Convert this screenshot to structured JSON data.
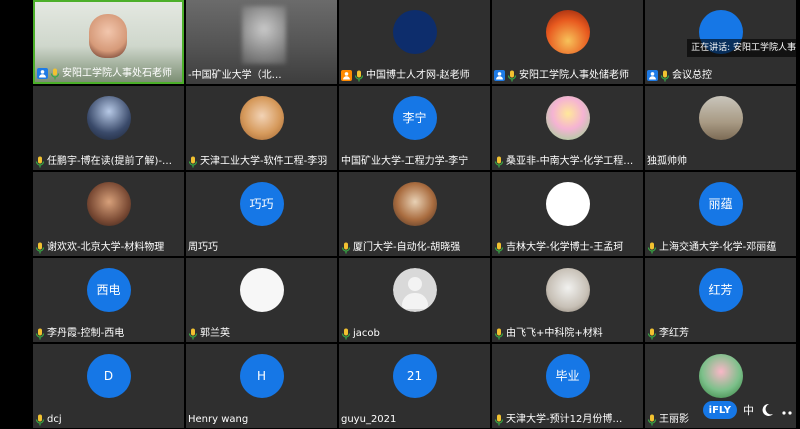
{
  "speaking_banner": "正在讲话: 安阳工学院人事",
  "tiles": [
    {
      "name": "tile-1",
      "label": "安阳工学院人事处石老师",
      "host": true,
      "hostBadge": "blue",
      "mic": true,
      "kind": "video-1",
      "active": true
    },
    {
      "name": "tile-2",
      "label": "-中国矿业大学（北…",
      "host": false,
      "mic": false,
      "kind": "video-2",
      "active": false
    },
    {
      "name": "tile-3",
      "label": "中国博士人才网-赵老师",
      "host": true,
      "hostBadge": "orange",
      "mic": true,
      "kind": "img",
      "imgClass": "logo1",
      "active": false
    },
    {
      "name": "tile-4",
      "label": "安阳工学院人事处储老师",
      "host": true,
      "hostBadge": "blue",
      "mic": true,
      "kind": "img",
      "imgClass": "logo2",
      "active": false
    },
    {
      "name": "tile-5",
      "label": "会议总控",
      "host": true,
      "hostBadge": "blue",
      "mic": true,
      "kind": "img",
      "imgClass": "partial",
      "active": false
    },
    {
      "name": "tile-6",
      "label": "任鹏宇-博在读(提前了解)-…",
      "host": false,
      "mic": true,
      "kind": "img",
      "imgClass": "c1",
      "active": false
    },
    {
      "name": "tile-7",
      "label": "天津工业大学-软件工程-李羽",
      "host": false,
      "mic": true,
      "kind": "img",
      "imgClass": "c2",
      "active": false
    },
    {
      "name": "tile-8",
      "label": "中国矿业大学-工程力学-李宁",
      "host": false,
      "mic": false,
      "kind": "text",
      "avatarText": "李宁",
      "active": false
    },
    {
      "name": "tile-9",
      "label": "桑亚非-中南大学-化学工程…",
      "host": false,
      "mic": true,
      "kind": "img",
      "imgClass": "c3",
      "active": false
    },
    {
      "name": "tile-10",
      "label": "独孤帅帅",
      "host": false,
      "mic": false,
      "kind": "img",
      "imgClass": "c4",
      "active": false
    },
    {
      "name": "tile-11",
      "label": "谢欢欢-北京大学-材料物理",
      "host": false,
      "mic": true,
      "kind": "img",
      "imgClass": "c5",
      "active": false
    },
    {
      "name": "tile-12",
      "label": "周巧巧",
      "host": false,
      "mic": false,
      "kind": "text",
      "avatarText": "巧巧",
      "active": false
    },
    {
      "name": "tile-13",
      "label": "厦门大学-自动化-胡晓强",
      "host": false,
      "mic": true,
      "kind": "img",
      "imgClass": "c6",
      "active": false
    },
    {
      "name": "tile-14",
      "label": "吉林大学-化学博士-王孟珂",
      "host": false,
      "mic": true,
      "kind": "img",
      "imgClass": "c7",
      "active": false
    },
    {
      "name": "tile-15",
      "label": "上海交通大学-化学-邓丽蕴",
      "host": false,
      "mic": true,
      "kind": "text",
      "avatarText": "丽蕴",
      "active": false
    },
    {
      "name": "tile-16",
      "label": "李丹霞-控制-西电",
      "host": false,
      "mic": true,
      "kind": "text",
      "avatarText": "西电",
      "active": false
    },
    {
      "name": "tile-17",
      "label": "郭兰英",
      "host": false,
      "mic": true,
      "kind": "img",
      "imgClass": "c8",
      "active": false
    },
    {
      "name": "tile-18",
      "label": "jacob",
      "host": false,
      "mic": true,
      "kind": "default",
      "active": false
    },
    {
      "name": "tile-19",
      "label": "由飞飞+中科院+材料",
      "host": false,
      "mic": true,
      "kind": "img",
      "imgClass": "c10",
      "active": false
    },
    {
      "name": "tile-20",
      "label": "李红芳",
      "host": false,
      "mic": true,
      "kind": "text",
      "avatarText": "红芳",
      "active": false
    },
    {
      "name": "tile-21",
      "label": "dcj",
      "host": false,
      "mic": true,
      "kind": "text",
      "avatarText": "D",
      "active": false
    },
    {
      "name": "tile-22",
      "label": "Henry wang",
      "host": false,
      "mic": false,
      "kind": "text",
      "avatarText": "H",
      "active": false
    },
    {
      "name": "tile-23",
      "label": "guyu_2021",
      "host": false,
      "mic": false,
      "kind": "text",
      "avatarText": "21",
      "active": false
    },
    {
      "name": "tile-24",
      "label": "天津大学-预计12月份博…",
      "host": false,
      "mic": true,
      "kind": "text",
      "avatarText": "毕业",
      "active": false
    },
    {
      "name": "tile-25",
      "label": "王丽影",
      "host": false,
      "mic": true,
      "kind": "img",
      "imgClass": "c11",
      "active": false
    }
  ],
  "toolbar": {
    "ime_label": "iFLY",
    "ime_lang": "中"
  },
  "colors": {
    "tile_bg": "#2f2f2f",
    "avatar_blue": "#1677e6",
    "active_border": "#4caf2a"
  }
}
